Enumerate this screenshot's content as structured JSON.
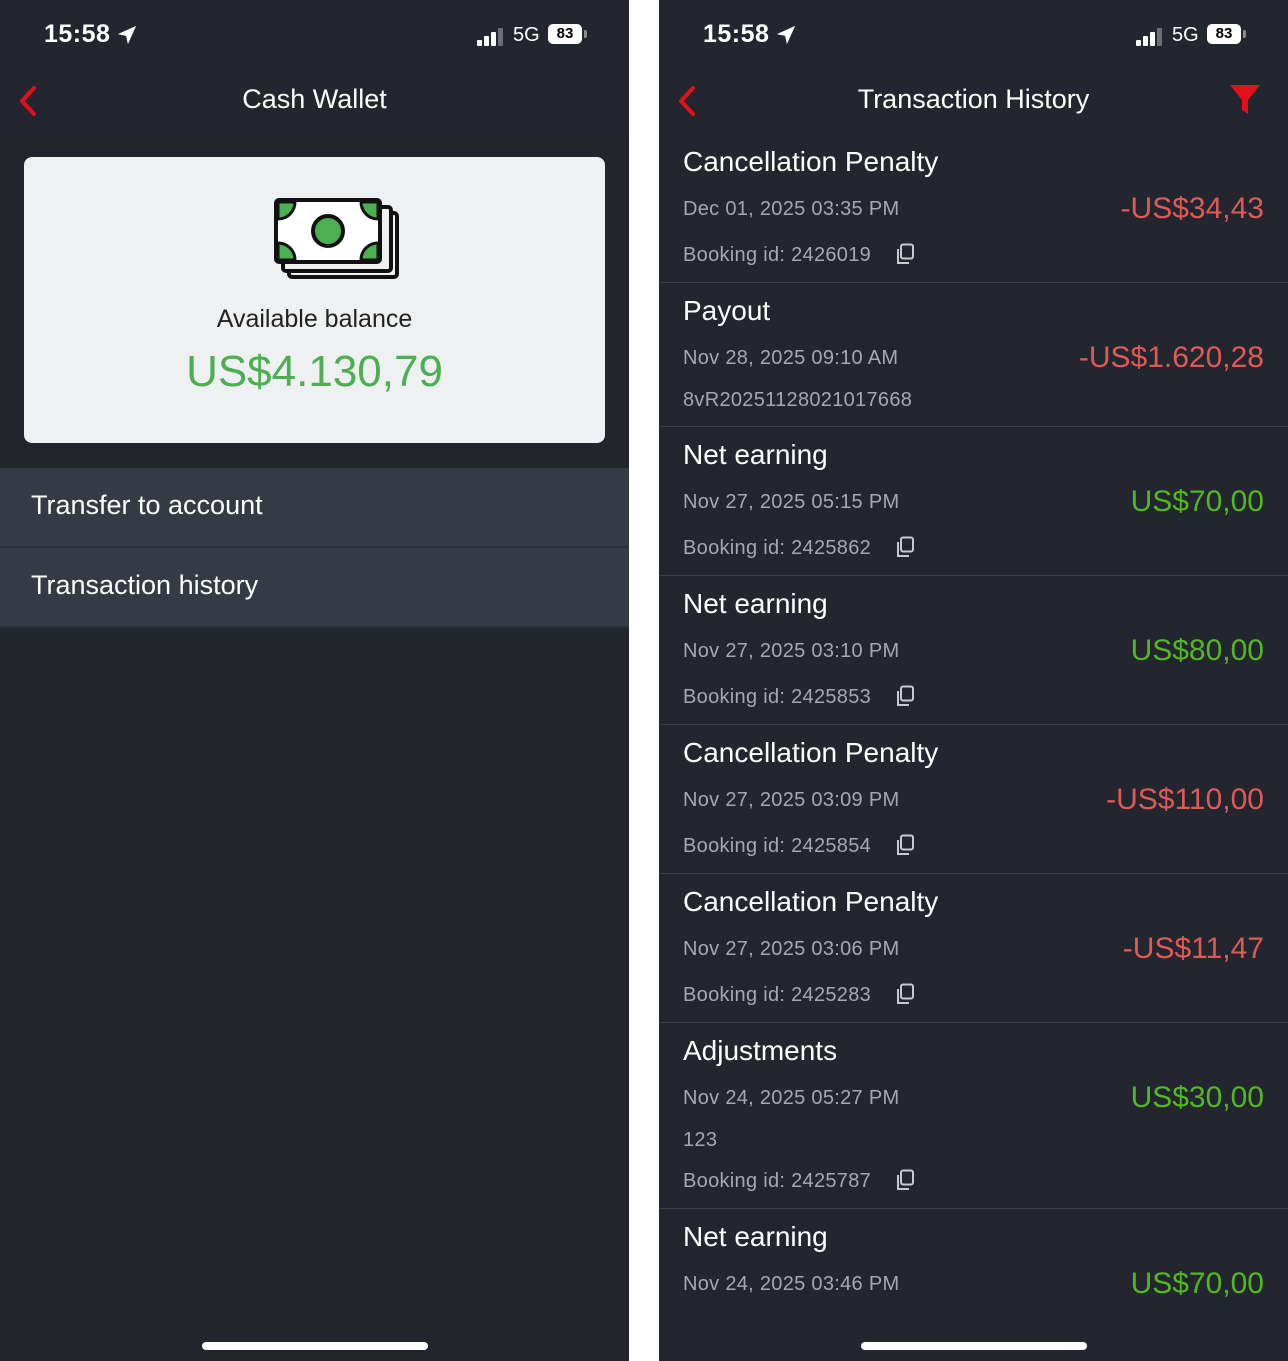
{
  "status_bar": {
    "time": "15:58",
    "network": "5G",
    "battery": "83"
  },
  "cash_wallet": {
    "title": "Cash Wallet",
    "balance_label": "Available balance",
    "balance_value": "US$4.130,79",
    "menu": [
      {
        "label": "Transfer to account"
      },
      {
        "label": "Transaction history"
      }
    ]
  },
  "transaction_history": {
    "title": "Transaction History",
    "transactions": [
      {
        "type": "Cancellation Penalty",
        "date": "Dec 01, 2025 03:35 PM",
        "amount": "-US$34,43",
        "booking": "Booking id: 2426019"
      },
      {
        "type": "Payout",
        "date": "Nov 28, 2025 09:10 AM",
        "amount": "-US$1.620,28",
        "reference": "8vR20251128021017668"
      },
      {
        "type": "Net earning",
        "date": "Nov 27, 2025 05:15 PM",
        "amount": "US$70,00",
        "booking": "Booking id: 2425862"
      },
      {
        "type": "Net earning",
        "date": "Nov 27, 2025 03:10 PM",
        "amount": "US$80,00",
        "booking": "Booking id: 2425853"
      },
      {
        "type": "Cancellation Penalty",
        "date": "Nov 27, 2025 03:09 PM",
        "amount": "-US$110,00",
        "booking": "Booking id: 2425854"
      },
      {
        "type": "Cancellation Penalty",
        "date": "Nov 27, 2025 03:06 PM",
        "amount": "-US$11,47",
        "booking": "Booking id: 2425283"
      },
      {
        "type": "Adjustments",
        "date": "Nov 24, 2025 05:27 PM",
        "amount": "US$30,00",
        "note": "123",
        "booking": "Booking id: 2425787"
      },
      {
        "type": "Net earning",
        "date": "Nov 24, 2025 03:46 PM",
        "amount": "US$70,00"
      }
    ]
  },
  "colors": {
    "background": "#23262e",
    "accent_red": "#e3101b",
    "negative": "#e05a55",
    "positive": "#52b820",
    "balance_green": "#4caf50",
    "card": "#eef0f2",
    "menu_item": "#363a45"
  },
  "icons": {
    "back": "chevron-left-icon",
    "filter": "filter-icon",
    "copy": "copy-icon",
    "money": "money-stack-icon",
    "location": "location-arrow-icon",
    "signal": "signal-bars-icon"
  }
}
